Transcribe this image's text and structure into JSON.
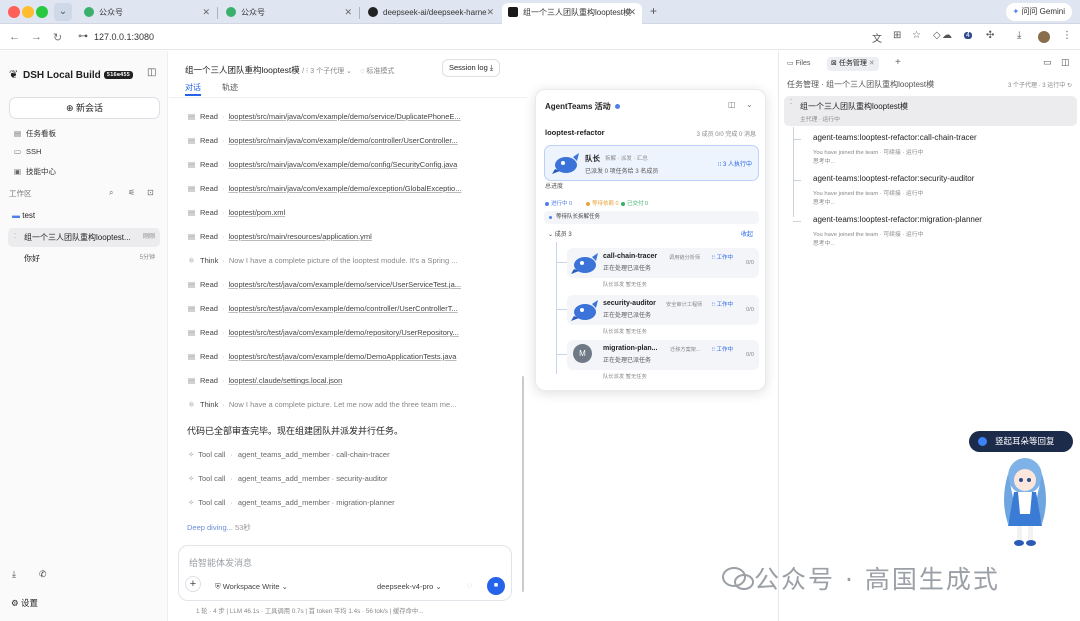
{
  "colors": {
    "accent": "#2563eb",
    "tabbar": "#dfe6f2",
    "leader_bg": "#eef4fe",
    "running": "#4f7fe8",
    "waiting": "#e8a33d",
    "done": "#3ab06b"
  },
  "browser": {
    "tabs": [
      {
        "label": "公众号",
        "icon": "wechat-icon"
      },
      {
        "label": "公众号",
        "icon": "wechat-icon"
      },
      {
        "label": "deepseek-ai/deepseek-harne",
        "icon": "github-icon"
      },
      {
        "label": "组一个三人团队重构looptest模",
        "icon": "dsh-icon"
      }
    ],
    "new_tab": "+",
    "gemini_label": "问问 Gemini",
    "url": "127.0.0.1:3080",
    "extension_badge": "4"
  },
  "sidebar": {
    "app_name": "DSH Local Build",
    "build_badge": "516e455",
    "new_chat": "新会话",
    "nav": [
      {
        "label": "任务看板",
        "icon": "kanban-icon"
      },
      {
        "label": "SSH",
        "icon": "terminal-icon"
      },
      {
        "label": "技能中心",
        "icon": "skills-icon"
      }
    ],
    "workspace_label": "工作区",
    "folder": "test",
    "sessions": [
      {
        "title": "组一个三人团队重构looptest...",
        "time": "刚刚",
        "active": true
      },
      {
        "title": "你好",
        "time": "5分钟",
        "active": false
      }
    ],
    "settings": "设置"
  },
  "chat": {
    "title": "组一个三人团队重构looptest模",
    "subagents": "3 个子代理",
    "mode": "标准模式",
    "session_log": "Session log",
    "tabs": [
      "对话",
      "轨迹"
    ],
    "rows": [
      {
        "type": "Read",
        "text": "looptest/src/main/java/com/example/demo/service/DuplicatePhoneE..."
      },
      {
        "type": "Read",
        "text": "looptest/src/main/java/com/example/demo/controller/UserController..."
      },
      {
        "type": "Read",
        "text": "looptest/src/main/java/com/example/demo/config/SecurityConfig.java"
      },
      {
        "type": "Read",
        "text": "looptest/src/main/java/com/example/demo/exception/GlobalExceptio..."
      },
      {
        "type": "Read",
        "text": "looptest/pom.xml"
      },
      {
        "type": "Read",
        "text": "looptest/src/main/resources/application.yml"
      },
      {
        "type": "Think",
        "text": "Now I have a complete picture of the looptest module. It's a Spring ..."
      },
      {
        "type": "Read",
        "text": "looptest/src/test/java/com/example/demo/service/UserServiceTest.ja..."
      },
      {
        "type": "Read",
        "text": "looptest/src/test/java/com/example/demo/controller/UserControllerT..."
      },
      {
        "type": "Read",
        "text": "looptest/src/test/java/com/example/demo/repository/UserRepository..."
      },
      {
        "type": "Read",
        "text": "looptest/src/test/java/com/example/demo/DemoApplicationTests.java"
      },
      {
        "type": "Read",
        "text": "looptest/.claude/settings.local.json"
      },
      {
        "type": "Think",
        "text": "Now I have a complete picture. Let me now add the three team me..."
      }
    ],
    "message": "代码已全部审查完毕。现在组建团队并派发并行任务。",
    "tool_calls": [
      {
        "label": "Tool call",
        "text": "agent_teams_add_member · call-chain-tracer"
      },
      {
        "label": "Tool call",
        "text": "agent_teams_add_member · security-auditor"
      },
      {
        "label": "Tool call",
        "text": "agent_teams_add_member · migration-planner"
      }
    ],
    "deep_diving": "Deep diving...",
    "deep_secs": "53秒",
    "input_placeholder": "给智能体发消息",
    "workspace_write": "Workspace Write",
    "model": "deepseek-v4-pro",
    "footer": "1 轮 · 4 步 | LLM 46.1s · 工具调用 0.7s | 首 token 平均 1.4s · 56 tok/s | 缓存命中..."
  },
  "panel": {
    "title": "AgentTeams 活动",
    "team": "looptest-refactor",
    "stats": "3 成员 0/0 完成 0 消息",
    "leader": {
      "name": "队长",
      "sub": "拆解 · 派发 · 汇总",
      "desc": "已派发 0 项任务给 3 名成员",
      "running": "3 人执行中"
    },
    "progress_label": "总进度",
    "legend": [
      {
        "label": "进行中 0",
        "color": "#4f7fe8"
      },
      {
        "label": "等待依赖 0",
        "color": "#e8a33d"
      },
      {
        "label": "已交付 0",
        "color": "#3ab06b"
      }
    ],
    "waiting": "等待队长拆解任务",
    "members_label": "成员 3",
    "collapse": "收起",
    "members": [
      {
        "name": "call-chain-tracer",
        "role": "调用链分析师",
        "state": "工作中",
        "count": "0/0",
        "desc": "正在处理已派任务",
        "meta1": "队长派发",
        "meta2": "暂无任务",
        "avatar": "mascot"
      },
      {
        "name": "security-auditor",
        "role": "安全审计工程师",
        "state": "工作中",
        "count": "0/0",
        "desc": "正在处理已派任务",
        "meta1": "队长派发",
        "meta2": "暂无任务",
        "avatar": "mascot"
      },
      {
        "name": "migration-plan...",
        "role": "迁移方案架...",
        "state": "工作中",
        "count": "0/0",
        "desc": "正在处理已派任务",
        "meta1": "队长派发",
        "meta2": "暂无任务",
        "avatar": "M"
      }
    ]
  },
  "right": {
    "tabs": [
      "Files",
      "任务管理"
    ],
    "header": "任务管理 · 组一个三人团队重构looptest模",
    "header_right": "3 个子代理 · 3 运行中",
    "main_task": {
      "title": "组一个三人团队重构looptest模",
      "sub": "主代理 · 运行中"
    },
    "subtasks": [
      {
        "title": "agent-teams:looptest-refactor:call-chain-tracer",
        "sub": "You have joined the team · 可续接 · 运行中",
        "sub2": "思考中..."
      },
      {
        "title": "agent-teams:looptest-refactor:security-auditor",
        "sub": "You have joined the team · 可续接 · 运行中",
        "sub2": "思考中..."
      },
      {
        "title": "agent-teams:looptest-refactor:migration-planner",
        "sub": "You have joined the team · 可续接 · 运行中",
        "sub2": "思考中..."
      }
    ]
  },
  "overlay": {
    "reply_button": "竖起耳朵等回复",
    "watermark": "公众号 · 高国生成式"
  }
}
